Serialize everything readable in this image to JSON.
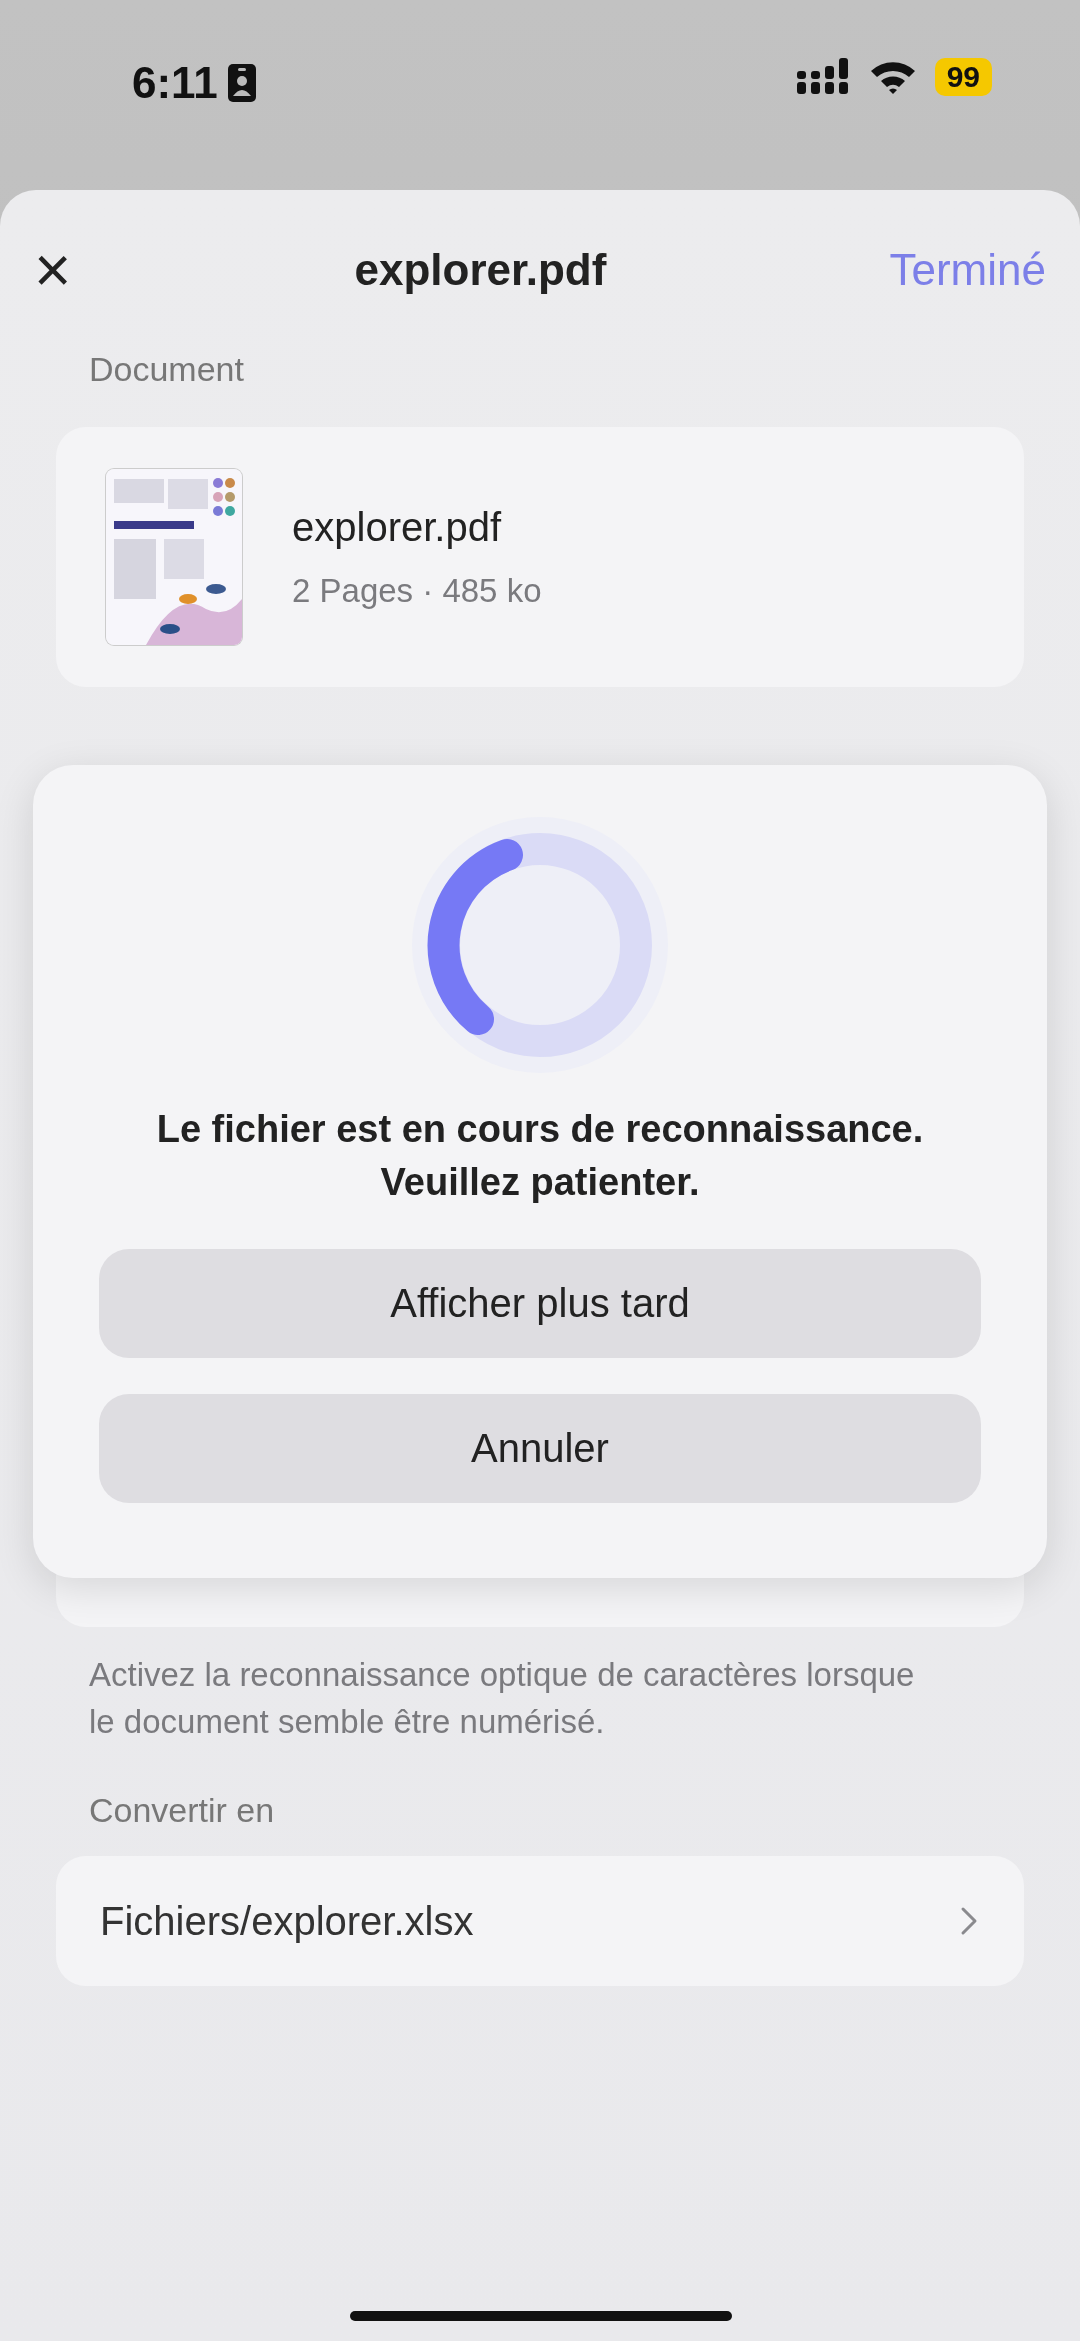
{
  "status_bar": {
    "time": "6:11",
    "battery": "99"
  },
  "header": {
    "close": "×",
    "title": "explorer.pdf",
    "done": "Terminé"
  },
  "document": {
    "section_label": "Document",
    "file_name": "explorer.pdf",
    "meta": "2 Pages · 485 ko"
  },
  "ocr_hint": "Activez la reconnaissance optique de caractères lorsque le document semble être numérisé.",
  "convert": {
    "section_label": "Convertir en",
    "path": "Fichiers/explorer.xlsx"
  },
  "dialog": {
    "message_lines": [
      "Le fichier est en cours de reconnaissance.",
      "Veuillez patienter."
    ],
    "buttons": [
      "Afficher plus tard",
      "Annuler"
    ]
  }
}
